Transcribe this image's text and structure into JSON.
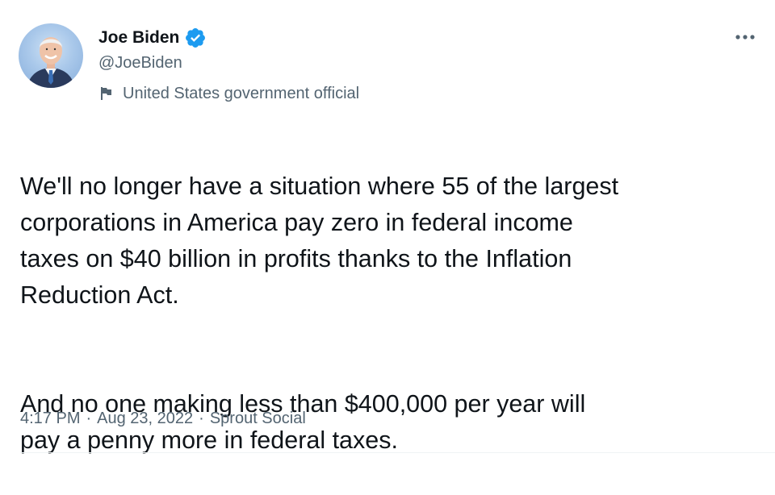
{
  "author": {
    "display_name": "Joe Biden",
    "handle": "@JoeBiden",
    "verified": true,
    "affiliation_label": "United States government official",
    "avatar_icon": "avatar-photo"
  },
  "tweet": {
    "paragraphs": [
      "We'll no longer have a situation where 55 of the largest\ncorporations in America pay zero in federal income\ntaxes on $40 billion in profits thanks to the Inflation\nReduction Act.",
      "And no one making less than $400,000 per year will\npay a penny more in federal taxes."
    ],
    "time": "4:17 PM",
    "date": "Aug 23, 2022",
    "source": "Sprout Social",
    "separator": "·"
  },
  "colors": {
    "text": "#0f1419",
    "secondary": "#536471",
    "verified": "#1d9bf0",
    "divider": "#eff3f4"
  }
}
